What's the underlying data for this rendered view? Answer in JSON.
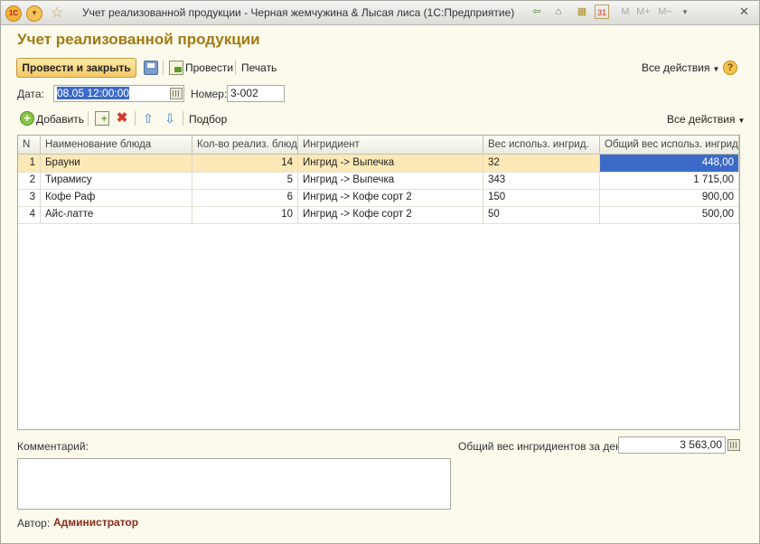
{
  "window": {
    "title": "Учет реализованной продукции - Черная жемчужина & Лысая лиса  (1С:Предприятие)",
    "logo_text": "1С",
    "menu_glyph": "▾",
    "star_glyph": "☆",
    "close_glyph": "✕",
    "toolbar_glyphs": {
      "back": "⇦",
      "home": "⌂",
      "calc": "▦",
      "calendar": "31",
      "m": "M",
      "mplus": "M+",
      "mminus": "M−",
      "more": "▾"
    }
  },
  "form": {
    "title": "Учет реализованной продукции"
  },
  "toolbar": {
    "post_close_label": "Провести и закрыть",
    "post_label": "Провести",
    "print_label": "Печать",
    "all_actions_label": "Все действия",
    "help_glyph": "?"
  },
  "fields": {
    "date_label": "Дата:",
    "date_value": "08.05 12:00:00",
    "number_label": "Номер:",
    "number_value": "3-002"
  },
  "table_toolbar": {
    "add_label": "Добавить",
    "add_glyph": "+",
    "delete_glyph": "✖",
    "up_glyph": "⇧",
    "down_glyph": "⇩",
    "select_label": "Подбор",
    "all_actions_label": "Все действия"
  },
  "table": {
    "columns": [
      "N",
      "Наименование блюда",
      "Кол-во реализ. блюд",
      "Ингридиент",
      "Вес использ. ингрид.",
      "Общий вес использ. ингрид."
    ],
    "rows": [
      {
        "n": "1",
        "dish": "Брауни",
        "qty": "14",
        "ingredient": "Ингрид -> Выпечка",
        "weight": "32",
        "total": "448,00"
      },
      {
        "n": "2",
        "dish": "Тирамису",
        "qty": "5",
        "ingredient": "Ингрид -> Выпечка",
        "weight": "343",
        "total": "1 715,00"
      },
      {
        "n": "3",
        "dish": "Кофе Раф",
        "qty": "6",
        "ingredient": "Ингрид -> Кофе сорт 2",
        "weight": "150",
        "total": "900,00"
      },
      {
        "n": "4",
        "dish": "Айс-латте",
        "qty": "10",
        "ingredient": "Ингрид -> Кофе сорт 2",
        "weight": "50",
        "total": "500,00"
      }
    ]
  },
  "footer": {
    "comment_label": "Комментарий:",
    "comment_value": "",
    "total_label": "Общий вес ингридиентов за день:",
    "total_value": "3 563,00",
    "author_label": "Автор:",
    "author_value": "Администратор"
  }
}
